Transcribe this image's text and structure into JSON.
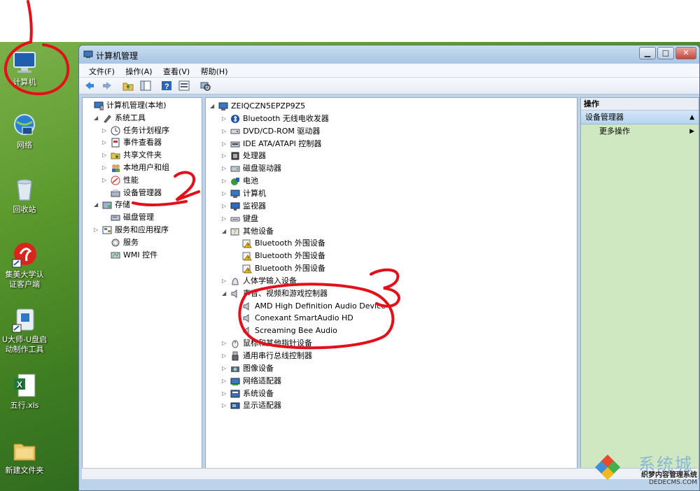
{
  "desktop": {
    "icons": [
      {
        "label": "计算机",
        "icon": "computer-icon"
      },
      {
        "label": "网络",
        "icon": "network-icon"
      },
      {
        "label": "回收站",
        "icon": "recycle-bin-icon"
      },
      {
        "label_line1": "集美大学认",
        "label_line2": "证客户端",
        "icon": "client-app-icon"
      },
      {
        "label_line1": "U大师-U盘启",
        "label_line2": "动制作工具",
        "icon": "usb-tool-icon"
      },
      {
        "label": "五行.xls",
        "icon": "excel-file-icon"
      },
      {
        "label": "新建文件夹",
        "icon": "folder-icon"
      }
    ]
  },
  "window": {
    "title": "计算机管理",
    "controls": {
      "minimize": "▁",
      "maximize": "□",
      "close": "✕"
    },
    "menu": [
      "文件(F)",
      "操作(A)",
      "查看(V)",
      "帮助(H)"
    ]
  },
  "left_tree": [
    {
      "label": "计算机管理(本地)",
      "level": 0,
      "expander": "",
      "icon": "computer-management-icon"
    },
    {
      "label": "系统工具",
      "level": 1,
      "expander": "◢",
      "icon": "system-tools-icon"
    },
    {
      "label": "任务计划程序",
      "level": 2,
      "expander": "▷",
      "icon": "task-scheduler-icon"
    },
    {
      "label": "事件查看器",
      "level": 2,
      "expander": "▷",
      "icon": "event-viewer-icon"
    },
    {
      "label": "共享文件夹",
      "level": 2,
      "expander": "▷",
      "icon": "shared-folders-icon"
    },
    {
      "label": "本地用户和组",
      "level": 2,
      "expander": "▷",
      "icon": "local-users-icon"
    },
    {
      "label": "性能",
      "level": 2,
      "expander": "▷",
      "icon": "performance-icon"
    },
    {
      "label": "设备管理器",
      "level": 2,
      "expander": "",
      "icon": "device-manager-icon"
    },
    {
      "label": "存储",
      "level": 1,
      "expander": "◢",
      "icon": "storage-icon"
    },
    {
      "label": "磁盘管理",
      "level": 2,
      "expander": "",
      "icon": "disk-management-icon"
    },
    {
      "label": "服务和应用程序",
      "level": 1,
      "expander": "▷",
      "icon": "services-apps-icon"
    },
    {
      "label": "服务",
      "level": 2,
      "expander": "",
      "icon": "services-icon"
    },
    {
      "label": "WMI 控件",
      "level": 2,
      "expander": "",
      "icon": "wmi-icon"
    }
  ],
  "device_tree": [
    {
      "label": "ZEIQCZN5EPZP9Z5",
      "level": 0,
      "expander": "◢",
      "icon": "computer-icon"
    },
    {
      "label": "Bluetooth 无线电收发器",
      "level": 1,
      "expander": "▷",
      "icon": "bluetooth-icon"
    },
    {
      "label": "DVD/CD-ROM 驱动器",
      "level": 1,
      "expander": "▷",
      "icon": "dvd-drive-icon"
    },
    {
      "label": "IDE ATA/ATAPI 控制器",
      "level": 1,
      "expander": "▷",
      "icon": "ide-controller-icon"
    },
    {
      "label": "处理器",
      "level": 1,
      "expander": "▷",
      "icon": "processor-icon"
    },
    {
      "label": "磁盘驱动器",
      "level": 1,
      "expander": "▷",
      "icon": "disk-drive-icon"
    },
    {
      "label": "电池",
      "level": 1,
      "expander": "▷",
      "icon": "battery-icon"
    },
    {
      "label": "计算机",
      "level": 1,
      "expander": "▷",
      "icon": "computer-icon"
    },
    {
      "label": "监视器",
      "level": 1,
      "expander": "▷",
      "icon": "monitor-icon"
    },
    {
      "label": "键盘",
      "level": 1,
      "expander": "▷",
      "icon": "keyboard-icon"
    },
    {
      "label": "其他设备",
      "level": 1,
      "expander": "◢",
      "icon": "other-devices-icon"
    },
    {
      "label": "Bluetooth 外围设备",
      "level": 2,
      "expander": "",
      "icon": "unknown-device-warning-icon"
    },
    {
      "label": "Bluetooth 外围设备",
      "level": 2,
      "expander": "",
      "icon": "unknown-device-warning-icon"
    },
    {
      "label": "Bluetooth 外围设备",
      "level": 2,
      "expander": "",
      "icon": "unknown-device-warning-icon"
    },
    {
      "label": "人体学输入设备",
      "level": 1,
      "expander": "▷",
      "icon": "hid-icon"
    },
    {
      "label": "声音、视频和游戏控制器",
      "level": 1,
      "expander": "◢",
      "icon": "speaker-icon"
    },
    {
      "label": "AMD High Definition Audio Device",
      "level": 2,
      "expander": "",
      "icon": "speaker-icon"
    },
    {
      "label": "Conexant SmartAudio HD",
      "level": 2,
      "expander": "",
      "icon": "speaker-icon"
    },
    {
      "label": "Screaming Bee Audio",
      "level": 2,
      "expander": "",
      "icon": "speaker-icon"
    },
    {
      "label": "鼠标和其他指针设备",
      "level": 1,
      "expander": "▷",
      "icon": "mouse-icon"
    },
    {
      "label": "通用串行总线控制器",
      "level": 1,
      "expander": "▷",
      "icon": "usb-icon"
    },
    {
      "label": "图像设备",
      "level": 1,
      "expander": "▷",
      "icon": "camera-icon"
    },
    {
      "label": "网络适配器",
      "level": 1,
      "expander": "▷",
      "icon": "network-adapter-icon"
    },
    {
      "label": "系统设备",
      "level": 1,
      "expander": "▷",
      "icon": "system-device-icon"
    },
    {
      "label": "显示适配器",
      "level": 1,
      "expander": "▷",
      "icon": "display-adapter-icon"
    }
  ],
  "actions_pane": {
    "header": "操作",
    "selected": "设备管理器",
    "more": "更多操作"
  },
  "annotations": [
    "1",
    "2",
    "3"
  ],
  "colors": {
    "annotation": "#e3101a",
    "actions_bg": "#cfe8c2",
    "selection": "#b5d3f0"
  },
  "watermark": {
    "brand": "系统城",
    "line1": "织梦内容管理系统",
    "line2": "DEDECMS.COM"
  }
}
